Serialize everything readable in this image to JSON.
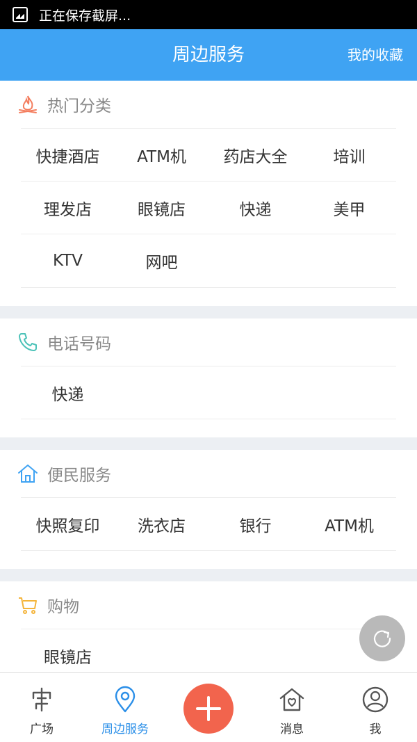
{
  "status_bar": {
    "text": "正在保存截屏..."
  },
  "header": {
    "title": "周边服务",
    "favorites": "我的收藏"
  },
  "sections": [
    {
      "title": "热门分类",
      "icon": "fire-icon",
      "color": "#f47d5e",
      "items": [
        "快捷酒店",
        "ATM机",
        "药店大全",
        "培训",
        "理发店",
        "眼镜店",
        "快递",
        "美甲",
        "KTV",
        "网吧"
      ]
    },
    {
      "title": "电话号码",
      "icon": "phone-icon",
      "color": "#4cc2b8",
      "items": [
        "快递"
      ]
    },
    {
      "title": "便民服务",
      "icon": "home-icon",
      "color": "#3fa3f3",
      "items": [
        "快照复印",
        "洗衣店",
        "银行",
        "ATM机"
      ]
    },
    {
      "title": "购物",
      "icon": "cart-icon",
      "color": "#f4b43a",
      "items": [
        "眼镜店"
      ]
    }
  ],
  "tabbar": {
    "tabs": [
      {
        "label": "广场",
        "icon": "plaza-icon"
      },
      {
        "label": "周边服务",
        "icon": "location-pin-icon",
        "active": true
      },
      {
        "label": "消息",
        "icon": "message-house-icon"
      },
      {
        "label": "我",
        "icon": "user-icon"
      }
    ],
    "center_icon": "plus-icon"
  },
  "colors": {
    "accent": "#3fa3f3",
    "plus": "#f2644d",
    "float": "#b9b9b9"
  }
}
